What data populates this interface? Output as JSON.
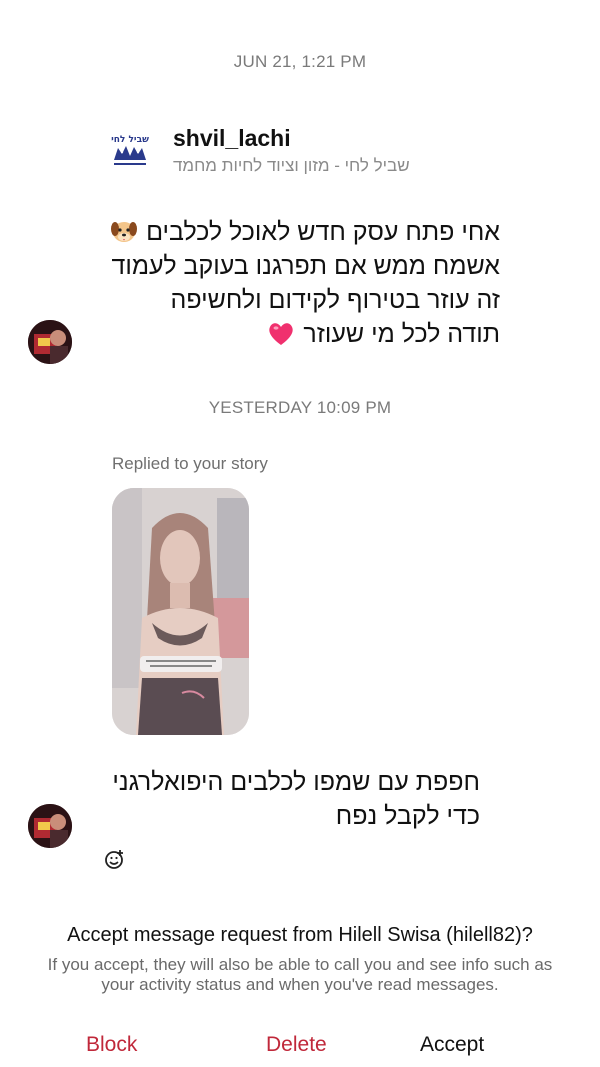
{
  "header": {
    "username_partial": "hilell82"
  },
  "timestamps": {
    "first": "JUN 21, 1:21 PM",
    "second": "YESTERDAY 10:09 PM"
  },
  "shared_profile": {
    "username": "shvil_lachi",
    "subtitle": "שביל לחי - מזון וציוד לחיות מחמד",
    "logo_text": "שביל לחי"
  },
  "message1": {
    "line1": "אחי פתח עסק חדש לאוכל לכלבים",
    "line2": "אשמח ממש אם תפרגנו בעוקב לעמוד",
    "line3": "זה עוזר בטירוף לקידום ולחשיפה",
    "line4": "תודה לכל מי שעוזר"
  },
  "story_reply": {
    "label": "Replied to your story"
  },
  "message2": {
    "line1": "חפפת עם שמפו לכלבים היפואלרגני",
    "line2": "כדי לקבל נפח"
  },
  "request": {
    "title": "Accept message request from Hilell Swisa (hilell82)?",
    "description": "If you accept, they will also be able to call you and see info such as your activity status and when you've read messages."
  },
  "actions": {
    "block": "Block",
    "delete": "Delete",
    "accept": "Accept"
  },
  "colors": {
    "destructive": "#c0283a",
    "muted_text": "#7a7a7a"
  }
}
